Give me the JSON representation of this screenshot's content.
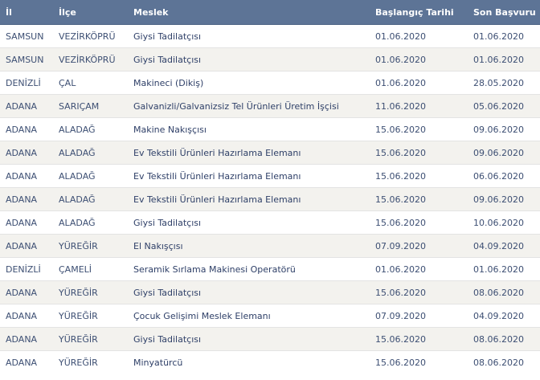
{
  "columns": {
    "il": "İl",
    "ilce": "İlçe",
    "meslek": "Meslek",
    "baslangic": "Başlangıç Tarihi",
    "son": "Son Başvuru"
  },
  "rows": [
    {
      "il": "SAMSUN",
      "ilce": "VEZİRKÖPRÜ",
      "meslek": "Giysi Tadilatçısı",
      "baslangic": "01.06.2020",
      "son": "01.06.2020"
    },
    {
      "il": "SAMSUN",
      "ilce": "VEZİRKÖPRÜ",
      "meslek": "Giysi Tadilatçısı",
      "baslangic": "01.06.2020",
      "son": "01.06.2020"
    },
    {
      "il": "DENİZLİ",
      "ilce": "ÇAL",
      "meslek": "Makineci (Dikiş)",
      "baslangic": "01.06.2020",
      "son": "28.05.2020"
    },
    {
      "il": "ADANA",
      "ilce": "SARIÇAM",
      "meslek": "Galvanizli/Galvanizsiz Tel Ürünleri Üretim İşçisi",
      "baslangic": "11.06.2020",
      "son": "05.06.2020"
    },
    {
      "il": "ADANA",
      "ilce": "ALADAĞ",
      "meslek": "Makine Nakışçısı",
      "baslangic": "15.06.2020",
      "son": "09.06.2020"
    },
    {
      "il": "ADANA",
      "ilce": "ALADAĞ",
      "meslek": "Ev Tekstili Ürünleri Hazırlama Elemanı",
      "baslangic": "15.06.2020",
      "son": "09.06.2020"
    },
    {
      "il": "ADANA",
      "ilce": "ALADAĞ",
      "meslek": "Ev Tekstili Ürünleri Hazırlama Elemanı",
      "baslangic": "15.06.2020",
      "son": "06.06.2020"
    },
    {
      "il": "ADANA",
      "ilce": "ALADAĞ",
      "meslek": "Ev Tekstili Ürünleri Hazırlama Elemanı",
      "baslangic": "15.06.2020",
      "son": "09.06.2020"
    },
    {
      "il": "ADANA",
      "ilce": "ALADAĞ",
      "meslek": "Giysi Tadilatçısı",
      "baslangic": "15.06.2020",
      "son": "10.06.2020"
    },
    {
      "il": "ADANA",
      "ilce": "YÜREĞİR",
      "meslek": "El Nakışçısı",
      "baslangic": "07.09.2020",
      "son": "04.09.2020"
    },
    {
      "il": "DENİZLİ",
      "ilce": "ÇAMELİ",
      "meslek": "Seramik Sırlama Makinesi Operatörü",
      "baslangic": "01.06.2020",
      "son": "01.06.2020"
    },
    {
      "il": "ADANA",
      "ilce": "YÜREĞİR",
      "meslek": "Giysi Tadilatçısı",
      "baslangic": "15.06.2020",
      "son": "08.06.2020"
    },
    {
      "il": "ADANA",
      "ilce": "YÜREĞİR",
      "meslek": "Çocuk Gelişimi Meslek Elemanı",
      "baslangic": "07.09.2020",
      "son": "04.09.2020"
    },
    {
      "il": "ADANA",
      "ilce": "YÜREĞİR",
      "meslek": "Giysi Tadilatçısı",
      "baslangic": "15.06.2020",
      "son": "08.06.2020"
    },
    {
      "il": "ADANA",
      "ilce": "YÜREĞİR",
      "meslek": "Minyatürcü",
      "baslangic": "15.06.2020",
      "son": "08.06.2020"
    }
  ]
}
